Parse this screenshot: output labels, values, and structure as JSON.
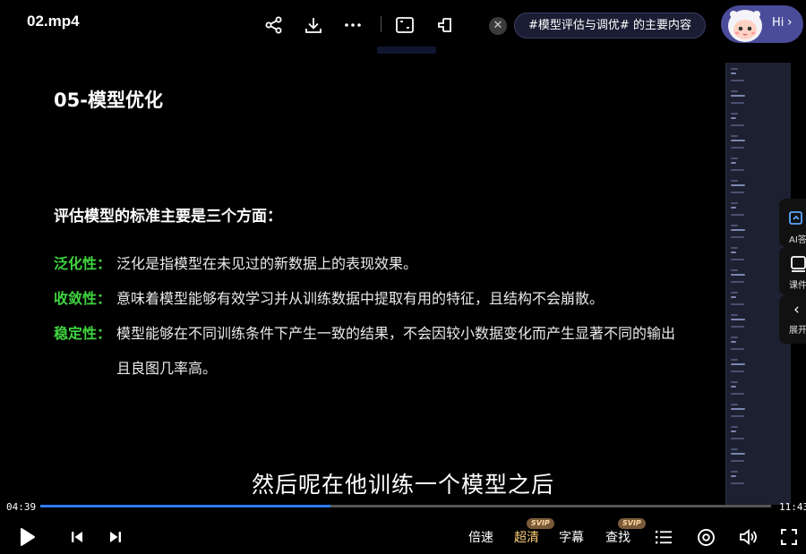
{
  "title": "02.mp4",
  "topic_pill": "#模型评估与调优# 的主要内容",
  "assistant": {
    "greeting": "Hi"
  },
  "slide": {
    "title": "05-模型优化",
    "heading": "评估模型的标准主要是三个方面：",
    "items": [
      {
        "term": "泛化性：",
        "lines": [
          "泛化是指模型在未见过的新数据上的表现效果。"
        ]
      },
      {
        "term": "收敛性：",
        "lines": [
          "意味着模型能够有效学习并从训练数据中提取有用的特征，且结构不会崩散。"
        ]
      },
      {
        "term": "稳定性：",
        "lines": [
          "模型能够在不同训练条件下产生一致的结果，不会因较小数据变化而产生显著不同的输出",
          "且良图几率高。"
        ]
      }
    ]
  },
  "side_actions": [
    {
      "label": "AI答",
      "icon": "ai-camera-icon"
    },
    {
      "label": "课件",
      "icon": "courseware-icon"
    },
    {
      "label": "展开",
      "icon": "expand-chevron-icon"
    }
  ],
  "subtitle": "然后呢在他训练一个模型之后",
  "player": {
    "current_time": "04:39",
    "total_time": "11:43",
    "progress": 0.397
  },
  "controls": {
    "speed": "倍速",
    "quality": "超清",
    "captions": "字幕",
    "search": "查找",
    "svip_badge": "SVIP"
  },
  "colors": {
    "accent": "#2f7bff",
    "term": "#3fd43f",
    "quality": "#ffcf7a"
  }
}
